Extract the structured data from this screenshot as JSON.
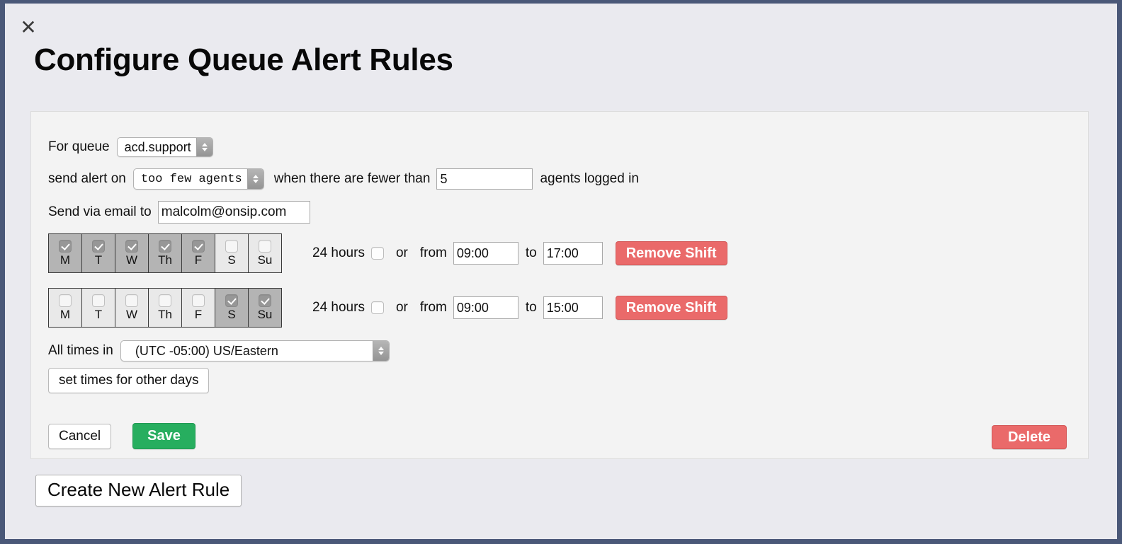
{
  "window": {
    "close_icon": "close-icon",
    "title": "Configure Queue Alert Rules"
  },
  "rule": {
    "queue_label": "For queue",
    "queue_value": "acd.support",
    "alert_on_label": "send alert on",
    "alert_on_value": "too few agents",
    "threshold_prefix": "when there are fewer than",
    "threshold_value": "5",
    "threshold_suffix": "agents logged in",
    "email_label": "Send via email to",
    "email_value": "malcolm@onsip.com",
    "timezone_label": "All times in",
    "timezone_value": "(UTC -05:00) US/Eastern",
    "set_times_label": "set times for other days",
    "day_labels": [
      "M",
      "T",
      "W",
      "Th",
      "F",
      "S",
      "Su"
    ],
    "shifts": [
      {
        "days_checked": [
          true,
          true,
          true,
          true,
          true,
          false,
          false
        ],
        "all_day_label": "24 hours",
        "all_day_checked": false,
        "or_label": "or",
        "from_label": "from",
        "from_value": "09:00",
        "to_label": "to",
        "to_value": "17:00",
        "remove_label": "Remove Shift"
      },
      {
        "days_checked": [
          false,
          false,
          false,
          false,
          false,
          true,
          true
        ],
        "all_day_label": "24 hours",
        "all_day_checked": false,
        "or_label": "or",
        "from_label": "from",
        "from_value": "09:00",
        "to_label": "to",
        "to_value": "15:00",
        "remove_label": "Remove Shift"
      }
    ],
    "cancel_label": "Cancel",
    "save_label": "Save",
    "delete_label": "Delete"
  },
  "footer": {
    "create_label": "Create New Alert Rule"
  },
  "colors": {
    "frame": "#4a5878",
    "page_bg": "#eaeaef",
    "card_bg": "#f3f3f3",
    "danger": "#ea6a6a",
    "success": "#27ae5f",
    "day_selected": "#b4b4b4"
  }
}
